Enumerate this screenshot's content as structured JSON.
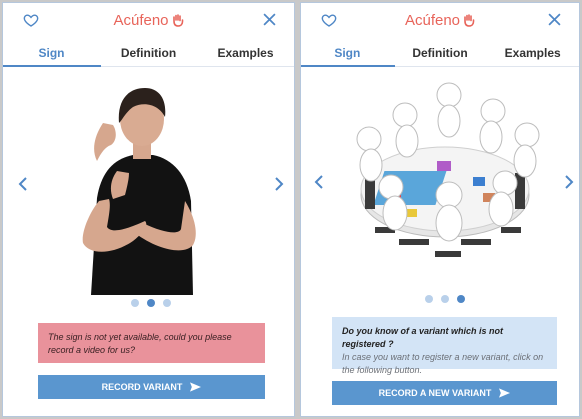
{
  "app": {
    "title": "Acúfeno"
  },
  "tabs": [
    "Sign",
    "Definition",
    "Examples"
  ],
  "left": {
    "notice": "The sign is not yet available, could you please record a video for us?",
    "button_label": "RECORD VARIANT",
    "carousel": {
      "total": 3,
      "active_index": 1
    }
  },
  "right": {
    "notice_question": "Do you know of a variant which is not registered ?",
    "notice_body": "In case you want to register a new variant, click on the following button.",
    "button_label": "RECORD A NEW VARIANT",
    "carousel": {
      "total": 3,
      "active_index": 2
    }
  },
  "colors": {
    "accent": "#4f87c6",
    "title": "#e8645a",
    "warning": "#e9929b",
    "info": "#d3e4f6",
    "button": "#5a96cf"
  }
}
